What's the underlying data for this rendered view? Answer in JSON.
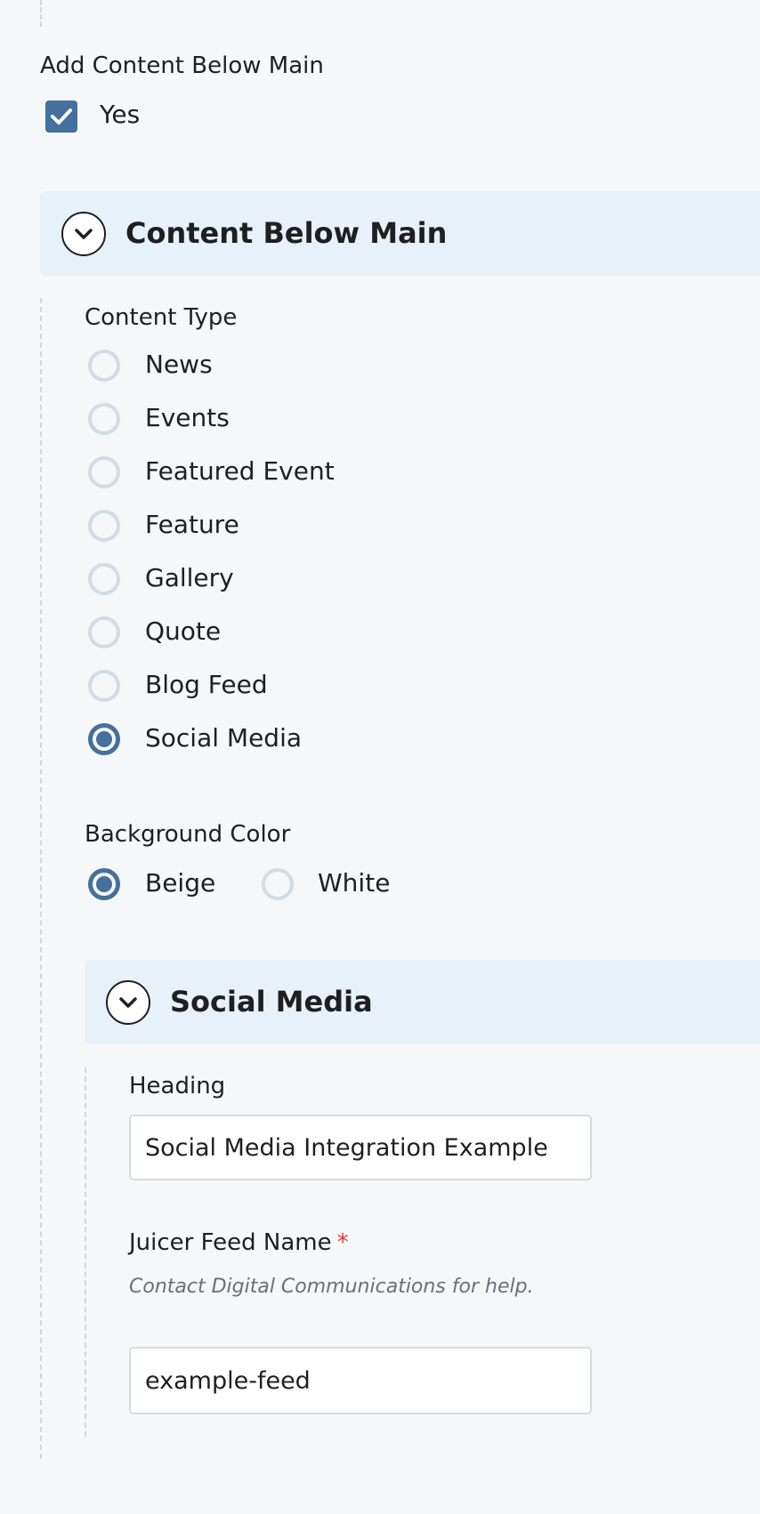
{
  "add_content_below_main": {
    "label": "Add Content Below Main",
    "checkbox": {
      "label": "Yes",
      "checked": true
    }
  },
  "content_below_main_panel": {
    "title": "Content Below Main",
    "toggle_icon": "chevron-down-icon",
    "content_type": {
      "label": "Content Type",
      "options": [
        {
          "label": "News",
          "selected": false
        },
        {
          "label": "Events",
          "selected": false
        },
        {
          "label": "Featured Event",
          "selected": false
        },
        {
          "label": "Feature",
          "selected": false
        },
        {
          "label": "Gallery",
          "selected": false
        },
        {
          "label": "Quote",
          "selected": false
        },
        {
          "label": "Blog Feed",
          "selected": false
        },
        {
          "label": "Social Media",
          "selected": true
        }
      ]
    },
    "background_color": {
      "label": "Background Color",
      "options": [
        {
          "label": "Beige",
          "selected": true
        },
        {
          "label": "White",
          "selected": false
        }
      ]
    }
  },
  "social_media_panel": {
    "title": "Social Media",
    "toggle_icon": "chevron-down-icon",
    "heading": {
      "label": "Heading",
      "value": "Social Media Integration Example"
    },
    "juicer_feed_name": {
      "label": "Juicer Feed Name",
      "required_marker": "*",
      "help": "Contact Digital Communications for help.",
      "value": "example-feed"
    }
  },
  "colors": {
    "accent": "#43709c",
    "panel_header_bg": "#e8f0f8",
    "page_bg": "#f6f7f9",
    "required": "#e53935"
  }
}
